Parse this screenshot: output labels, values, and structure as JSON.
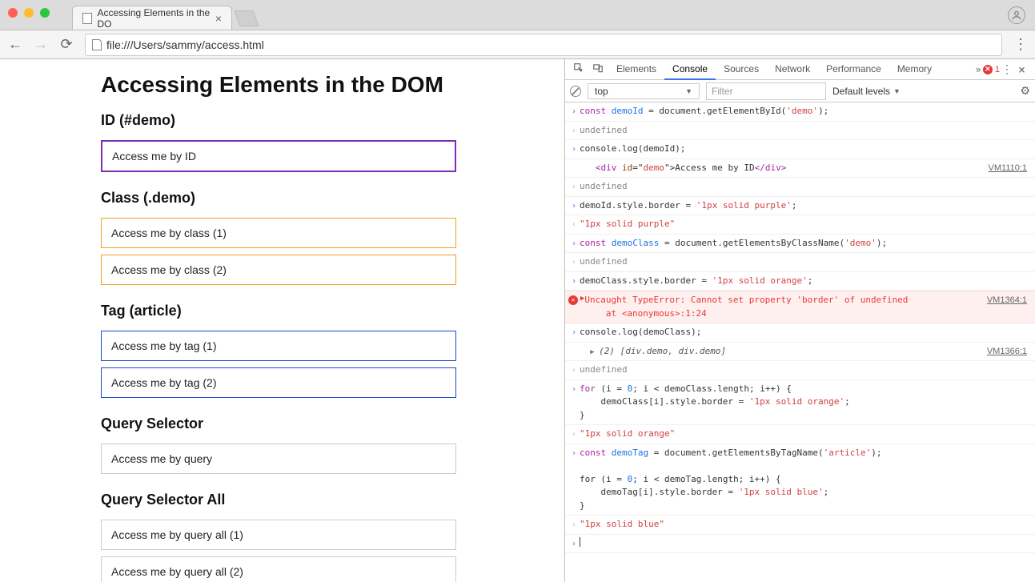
{
  "window": {
    "tab_title": "Accessing Elements in the DO",
    "url": "file:///Users/sammy/access.html"
  },
  "page": {
    "h1": "Accessing Elements in the DOM",
    "sections": [
      {
        "title": "ID (#demo)",
        "boxes": [
          "Access me by ID"
        ],
        "border": "purple"
      },
      {
        "title": "Class (.demo)",
        "boxes": [
          "Access me by class (1)",
          "Access me by class (2)"
        ],
        "border": "orange"
      },
      {
        "title": "Tag (article)",
        "boxes": [
          "Access me by tag (1)",
          "Access me by tag (2)"
        ],
        "border": "blue"
      },
      {
        "title": "Query Selector",
        "boxes": [
          "Access me by query"
        ],
        "border": ""
      },
      {
        "title": "Query Selector All",
        "boxes": [
          "Access me by query all (1)",
          "Access me by query all (2)"
        ],
        "border": ""
      }
    ]
  },
  "devtools": {
    "tabs": [
      "Elements",
      "Console",
      "Sources",
      "Network",
      "Performance",
      "Memory"
    ],
    "active_tab": "Console",
    "error_count": "1",
    "frame": "top",
    "filter_placeholder": "Filter",
    "levels": "Default levels",
    "lines": [
      {
        "mark": "in",
        "link": "",
        "segs": [
          {
            "t": "const ",
            "c": "c-kw"
          },
          {
            "t": "demoId",
            "c": "c-var"
          },
          {
            "t": " = document.getElementById("
          },
          {
            "t": "'demo'",
            "c": "c-str"
          },
          {
            "t": ");"
          }
        ]
      },
      {
        "mark": "out",
        "segs": [
          {
            "t": "undefined",
            "c": "c-undef"
          }
        ]
      },
      {
        "mark": "in",
        "segs": [
          {
            "t": "console.log(demoId);"
          }
        ]
      },
      {
        "mark": "",
        "link": "VM1110:1",
        "indent": "   ",
        "segs": [
          {
            "t": "<",
            "c": "c-tag"
          },
          {
            "t": "div",
            "c": "c-tag"
          },
          {
            "t": " id",
            "c": "c-attr"
          },
          {
            "t": "=\""
          },
          {
            "t": "demo",
            "c": "c-str"
          },
          {
            "t": "\">"
          },
          {
            "t": "Access me by ID"
          },
          {
            "t": "</",
            "c": "c-tag"
          },
          {
            "t": "div",
            "c": "c-tag"
          },
          {
            "t": ">",
            "c": "c-tag"
          }
        ]
      },
      {
        "mark": "out",
        "segs": [
          {
            "t": "undefined",
            "c": "c-undef"
          }
        ]
      },
      {
        "mark": "in",
        "segs": [
          {
            "t": "demoId.style.border = "
          },
          {
            "t": "'1px solid purple'",
            "c": "c-str"
          },
          {
            "t": ";"
          }
        ]
      },
      {
        "mark": "out",
        "segs": [
          {
            "t": "\"",
            "c": "c-str"
          },
          {
            "t": "1px solid purple",
            "c": "c-str"
          },
          {
            "t": "\"",
            "c": "c-str"
          }
        ]
      },
      {
        "mark": "in",
        "segs": [
          {
            "t": "const ",
            "c": "c-kw"
          },
          {
            "t": "demoClass",
            "c": "c-var"
          },
          {
            "t": " = document.getElementsByClassName("
          },
          {
            "t": "'demo'",
            "c": "c-str"
          },
          {
            "t": ");"
          }
        ]
      },
      {
        "mark": "out",
        "segs": [
          {
            "t": "undefined",
            "c": "c-undef"
          }
        ]
      },
      {
        "mark": "in",
        "segs": [
          {
            "t": "demoClass.style.border = "
          },
          {
            "t": "'1px solid orange'",
            "c": "c-str"
          },
          {
            "t": ";"
          }
        ]
      },
      {
        "mark": "err",
        "link": "VM1364:1",
        "text": "Uncaught TypeError: Cannot set property 'border' of undefined\n    at <anonymous>:1:24"
      },
      {
        "mark": "in",
        "segs": [
          {
            "t": "console.log(demoClass);"
          }
        ]
      },
      {
        "mark": "",
        "link": "VM1366:1",
        "indent": "  ",
        "tri": true,
        "segs": [
          {
            "t": "(2) ",
            "c": "c-ital"
          },
          {
            "t": "[",
            "c": "c-ital"
          },
          {
            "t": "div.demo",
            "c": "c-ital"
          },
          {
            "t": ", ",
            "c": "c-ital"
          },
          {
            "t": "div.demo",
            "c": "c-ital"
          },
          {
            "t": "]",
            "c": "c-ital"
          }
        ]
      },
      {
        "mark": "out",
        "segs": [
          {
            "t": "undefined",
            "c": "c-undef"
          }
        ]
      },
      {
        "mark": "in",
        "segs": [
          {
            "t": "for ",
            "c": "c-kw"
          },
          {
            "t": "(i = "
          },
          {
            "t": "0",
            "c": "c-num"
          },
          {
            "t": "; i < demoClass.length; i++) {\n    demoClass[i].style.border = "
          },
          {
            "t": "'1px solid orange'",
            "c": "c-str"
          },
          {
            "t": ";\n}"
          }
        ]
      },
      {
        "mark": "out",
        "segs": [
          {
            "t": "\"",
            "c": "c-str"
          },
          {
            "t": "1px solid orange",
            "c": "c-str"
          },
          {
            "t": "\"",
            "c": "c-str"
          }
        ]
      },
      {
        "mark": "in",
        "segs": [
          {
            "t": "const ",
            "c": "c-kw"
          },
          {
            "t": "demoTag",
            "c": "c-var"
          },
          {
            "t": " = document.getElementsByTagName("
          },
          {
            "t": "'article'",
            "c": "c-str"
          },
          {
            "t": ");\n\nfor (i = "
          },
          {
            "t": "0",
            "c": "c-num"
          },
          {
            "t": "; i < demoTag.length; i++) {\n    demoTag[i].style.border = "
          },
          {
            "t": "'1px solid blue'",
            "c": "c-str"
          },
          {
            "t": ";\n}"
          }
        ]
      },
      {
        "mark": "out",
        "segs": [
          {
            "t": "\"",
            "c": "c-str"
          },
          {
            "t": "1px solid blue",
            "c": "c-str"
          },
          {
            "t": "\"",
            "c": "c-str"
          }
        ]
      },
      {
        "mark": "in-empty"
      }
    ]
  }
}
